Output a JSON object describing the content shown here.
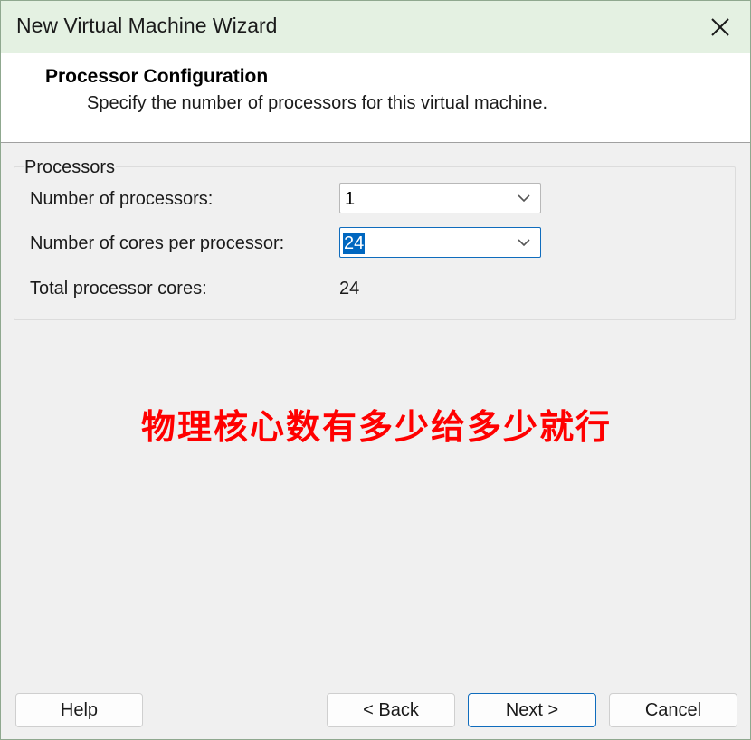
{
  "window": {
    "title": "New Virtual Machine Wizard",
    "close_icon": "close-icon"
  },
  "header": {
    "title": "Processor Configuration",
    "subtitle": "Specify the number of processors for this virtual machine."
  },
  "processors_group": {
    "legend": "Processors",
    "num_processors_label": "Number of processors:",
    "num_processors_value": "1",
    "cores_per_processor_label": "Number of cores per processor:",
    "cores_per_processor_value": "24",
    "total_cores_label": "Total processor cores:",
    "total_cores_value": "24"
  },
  "annotation": {
    "text": "物理核心数有多少给多少就行",
    "color": "#ff0000"
  },
  "buttons": {
    "help": "Help",
    "back": "< Back",
    "next": "Next >",
    "cancel": "Cancel"
  },
  "colors": {
    "titlebar": "#e4f1e2",
    "accent": "#0f6cbd",
    "selection": "#0067c0"
  }
}
